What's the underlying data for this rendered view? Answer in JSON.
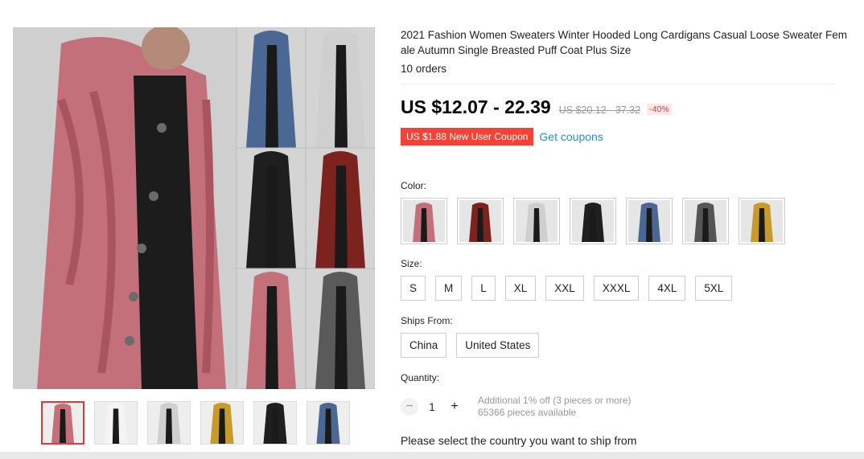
{
  "product": {
    "title": "2021 Fashion Women Sweaters Winter Hooded Long Cardigans Casual Loose Sweater Female Autumn Single Breasted Puff Coat Plus Size",
    "orders": "10 orders"
  },
  "price": {
    "current": "US $12.07 - 22.39",
    "original": "US $20.12 - 37.32",
    "discount": "-40%"
  },
  "coupon": {
    "badge": "US $1.88 New User Coupon",
    "link": "Get coupons"
  },
  "gallery": {
    "main_colors": [
      "#c4707a",
      "#4b6894",
      "#cfcfcf",
      "#1f1f1f",
      "#7c231f",
      "#c4707a",
      "#5a5a5a"
    ],
    "thumbs": [
      {
        "name": "thumb-collage",
        "color": "#c4707a"
      },
      {
        "name": "thumb-size-chart",
        "color": "#f4f4f4"
      },
      {
        "name": "thumb-white",
        "color": "#cfcfcf"
      },
      {
        "name": "thumb-yellow",
        "color": "#c79a2a"
      },
      {
        "name": "thumb-black",
        "color": "#1f1f1f"
      },
      {
        "name": "thumb-blue",
        "color": "#4b6894"
      }
    ]
  },
  "color": {
    "label": "Color:",
    "swatches": [
      "#c4707a",
      "#7c231f",
      "#cfcfcf",
      "#1f1f1f",
      "#4b6894",
      "#555555",
      "#c79a2a"
    ]
  },
  "size": {
    "label": "Size:",
    "options": [
      "S",
      "M",
      "L",
      "XL",
      "XXL",
      "XXXL",
      "4XL",
      "5XL"
    ]
  },
  "ships_from": {
    "label": "Ships From:",
    "options": [
      "China",
      "United States"
    ]
  },
  "quantity": {
    "label": "Quantity:",
    "minus": "−",
    "value": "1",
    "plus": "+",
    "note_line1": "Additional 1% off (3 pieces or more)",
    "note_line2": "65366 pieces available"
  },
  "ship_message": "Please select the country you want to ship from"
}
